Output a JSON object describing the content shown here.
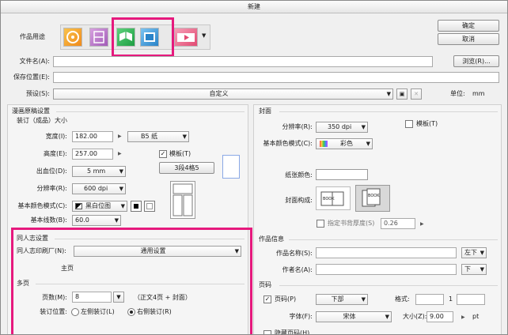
{
  "window": {
    "title": "新建"
  },
  "top": {
    "purpose_label": "作品用途",
    "ok_label": "确定",
    "cancel_label": "取消",
    "filename_label": "文件名(A):",
    "savepath_label": "保存位置(E):",
    "browse_label": "浏览(R)...",
    "preset_label": "预设(S):",
    "preset_value": "自定义",
    "unit_label": "单位:",
    "unit_value": "mm",
    "purpose_icons": [
      "illustration-icon",
      "webtoon-icon",
      "comic-icon",
      "photo-icon",
      "animation-icon"
    ]
  },
  "comic": {
    "section_title": "漫画原稿设置",
    "bound_size_label": "装订（成品）大小",
    "width_label": "宽度(I):",
    "width_value": "182.00",
    "height_label": "高度(E):",
    "height_value": "257.00",
    "paper_value": "B5 纸",
    "template_label": "模板(T)",
    "template_value": "3段4格5",
    "bleed_label": "出血位(D):",
    "bleed_value": "5 mm",
    "resolution_label": "分辨率(R):",
    "resolution_value": "600 dpi",
    "colormode_label": "基本颜色模式(C):",
    "colormode_value": "黑白位图",
    "lines_label": "基本线数(B):",
    "lines_value": "60.0"
  },
  "doujin": {
    "section_title": "同人志设置",
    "printer_label": "同人志印刷厂(N):",
    "printer_value": "通用设置",
    "main_label": "主页"
  },
  "multipage": {
    "section_title": "多页",
    "pages_label": "页数(M):",
    "pages_value": "8",
    "pages_note": "（正文4页 + 封面）",
    "binding_label": "装订位置:",
    "left_bind": "左侧装订(L)",
    "right_bind": "右侧装订(R)"
  },
  "cover": {
    "section_title": "封面",
    "template_label": "模板(T)",
    "resolution_label": "分辨率(R):",
    "resolution_value": "350 dpi",
    "colormode_label": "基本颜色模式(C):",
    "colormode_value": "彩色",
    "paper_color_label": "纸张颜色:",
    "structure_label": "封面构成:",
    "spine_label": "指定书背厚度(S)",
    "spine_value": "0.26"
  },
  "workinfo": {
    "section_title": "作品信息",
    "name_label": "作品名称(S):",
    "name_pos": "左下",
    "author_label": "作者名(A):",
    "author_pos": "下"
  },
  "pagenum": {
    "section_title": "页码",
    "pagenum_label": "页码(P)",
    "pos_value": "下部",
    "format_label": "格式:",
    "start_value": "1",
    "font_label": "字体(F):",
    "font_value": "宋体",
    "size_label": "大小(Z):",
    "size_value": "9.00",
    "size_unit": "pt",
    "hidden_label": "隐藏页码(H)"
  },
  "colors": {
    "highlight": "#e6197d"
  }
}
